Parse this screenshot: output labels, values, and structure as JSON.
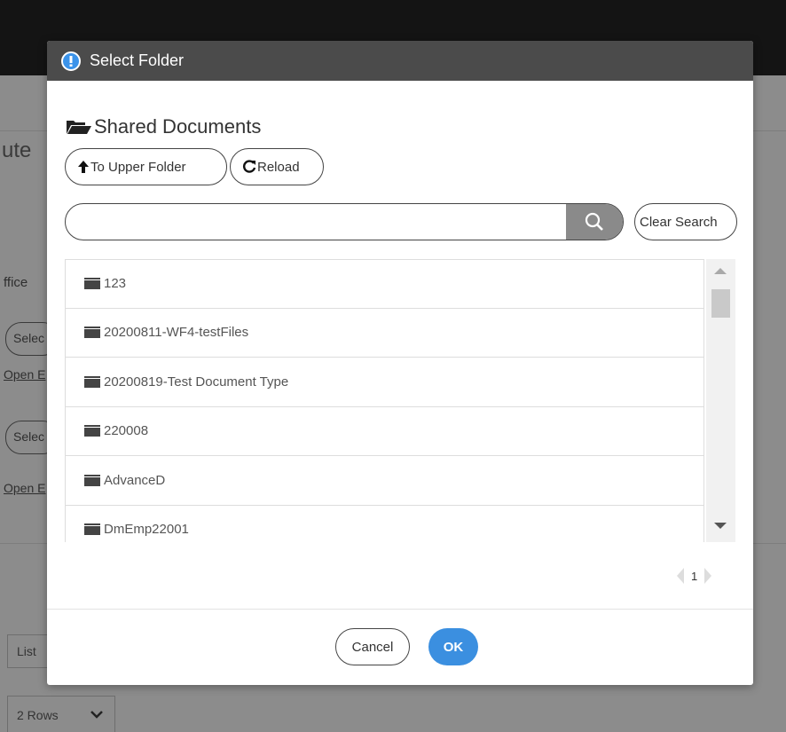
{
  "background": {
    "title_fragment": "ute",
    "office_fragment": "ffice",
    "select_label": "Selec",
    "open_label": "Open E",
    "list_label": "List",
    "rows_label": "2 Rows"
  },
  "dialog": {
    "title": "Select Folder",
    "icon": "info-icon",
    "current_folder": "Shared Documents",
    "upper_folder_label": "To Upper Folder",
    "reload_label": "Reload",
    "search": {
      "value": "",
      "placeholder": ""
    },
    "clear_search_label": "Clear Search",
    "folders": [
      {
        "name": "123"
      },
      {
        "name": "20200811-WF4-testFiles"
      },
      {
        "name": "20200819-Test Document Type"
      },
      {
        "name": "220008"
      },
      {
        "name": "AdvanceD"
      },
      {
        "name": "DmEmp22001"
      }
    ],
    "pagination": {
      "current_page": "1"
    },
    "cancel_label": "Cancel",
    "ok_label": "OK"
  },
  "colors": {
    "header": "#4b4b4b",
    "accent": "#3b8fe0",
    "overlay": "#8c8c8c"
  }
}
